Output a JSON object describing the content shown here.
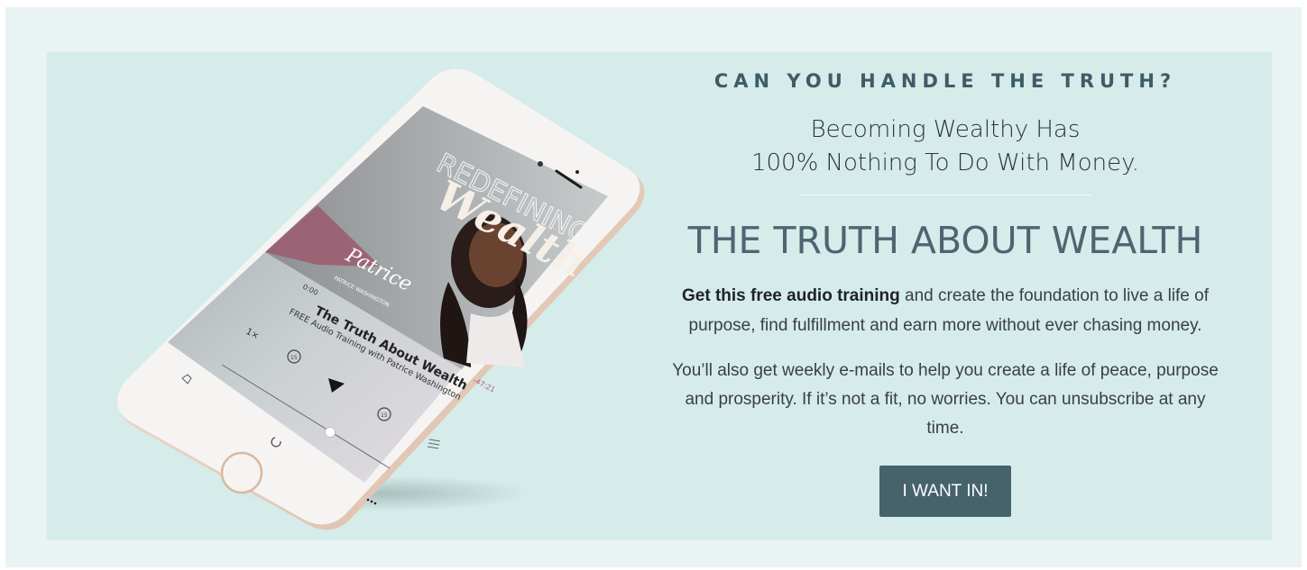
{
  "hero": {
    "eyebrow": "CAN YOU HANDLE THE TRUTH?",
    "subhead_line1": "Becoming Wealthy Has",
    "subhead_line2": "100% Nothing To Do With Money.",
    "headline": "THE TRUTH ABOUT WEALTH",
    "para1_bold": "Get this free audio training",
    "para1_rest_line1": " and create the foundation to live a life of",
    "para1_line2": "purpose, find fulfillment and earn more without ever chasing money.",
    "para2_line1": "You’ll also get weekly e-mails to help you create a life of peace, purpose",
    "para2_line2": "and prosperity. If it’s not a fit, no worries. You can unsubscribe at any",
    "para2_line3": "time.",
    "cta_label": "I WANT IN!"
  },
  "phone": {
    "cover_title_top": "REDEFINING",
    "cover_title_script": "Wealth",
    "cover_signature": "Patrice",
    "cover_name": "PATRICE WASHINGTON",
    "elapsed": "0:00",
    "remaining": "-47:21",
    "speed": "1×",
    "episode_title": "The Truth About Wealth",
    "episode_subtitle": "FREE Audio Training with Patrice Washington",
    "skip_back": "15",
    "skip_forward": "15"
  },
  "colors": {
    "page_bg": "#eaf3f4",
    "panel_bg": "#d5ecea",
    "accent": "#46626b",
    "headline": "#4b6571"
  }
}
